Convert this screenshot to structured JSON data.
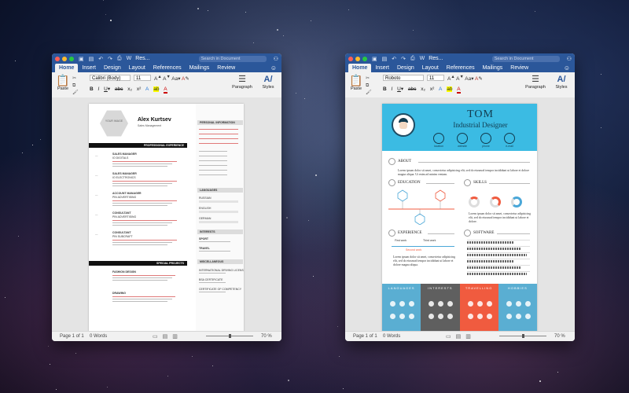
{
  "left_window": {
    "title": "Res...",
    "search_placeholder": "Search in Document",
    "tabs": [
      "Home",
      "Insert",
      "Design",
      "Layout",
      "References",
      "Mailings",
      "Review"
    ],
    "active_tab": "Home",
    "ribbon": {
      "paste_label": "Paste",
      "font_name": "Calibri (Body)",
      "font_size": "11",
      "paragraph_label": "Paragraph",
      "styles_label": "Styles"
    },
    "status": {
      "page": "Page 1 of 1",
      "words": "0 Words",
      "zoom": "70 %"
    },
    "resume": {
      "photo_label": "YOUR IMAGE",
      "name": "Alex Kurtsev",
      "role": "Sales Management",
      "professional_experience": "PROFESSIONAL EXPERIENCE",
      "special_projects": "SPECIAL PROJECTS",
      "personal_information": "PERSONAL INFORMATION",
      "languages": "LANGUAGES",
      "interests": "INTERESTS",
      "miscellaneous": "MISCELLANEOUS",
      "jobs": [
        {
          "title": "SALES MANAGER",
          "company": "IO DIGITALS"
        },
        {
          "title": "SALES MANAGER",
          "company": "IO ELECTRONICS"
        },
        {
          "title": "ACCOUNT MANAGER",
          "company": "PIN ADVERTISING"
        },
        {
          "title": "CONSULTANT",
          "company": "PIN ADVERTISING"
        },
        {
          "title": "CONSULTANT",
          "company": "PIN SUBCRAFT"
        }
      ],
      "projects": [
        {
          "title": "FASHION DESIGN"
        },
        {
          "title": "DRAWING"
        }
      ],
      "language_items": [
        "RUSSIAN",
        "ENGLISH",
        "GERMAN"
      ],
      "interest_items": [
        "SPORT",
        "TRAVEL"
      ],
      "misc_items": [
        "INTERNATIONAL DRIVING LICENSE",
        "BSA CERTIFICATE",
        "CERTIFICATE OF COMPETENCY"
      ]
    }
  },
  "right_window": {
    "title": "Res...",
    "search_placeholder": "Search in Document",
    "tabs": [
      "Home",
      "Insert",
      "Design",
      "Layout",
      "References",
      "Mailings",
      "Review"
    ],
    "active_tab": "Home",
    "ribbon": {
      "paste_label": "Paste",
      "font_name": "Roboto",
      "font_size": "11",
      "paragraph_label": "Paragraph",
      "styles_label": "Styles"
    },
    "status": {
      "page": "Page 1 of 1",
      "words": "0 Words",
      "zoom": "70 %"
    },
    "resume": {
      "name": "TOM",
      "title": "Industrial Designer",
      "contacts": [
        "location",
        "website",
        "phone",
        "e-mail"
      ],
      "about_heading": "ABOUT",
      "about_text": "Lorem ipsum dolor sit amet, consectetur adipisicing elit, sed do eiusmod tempor incididunt ut labore et dolore magna aliqua. Ut enim ad minim veniam.",
      "education_heading": "EDUCATION",
      "skills_heading": "SKILLS",
      "skills_text": "Lorem ipsum dolor sit amet, consectetur adipisicing elit, sed do eiusmod tempor incididunt ut labore et dolore.",
      "experience_heading": "EXPERIENCE",
      "software_heading": "SOFTWARE",
      "experience_items": [
        "First work",
        "Third work",
        "Second work"
      ],
      "experience_text": "Lorem ipsum dolor sit amet, consectetur adipisicing elit, sed do eiusmod tempor incididunt ut labore et dolore magna aliqua.",
      "panels": [
        {
          "title": "LANGUAGES",
          "color": "#5aaed2"
        },
        {
          "title": "INTERESTS",
          "color": "#5f5f5f"
        },
        {
          "title": "TRAVELLING",
          "color": "#f05b3f"
        },
        {
          "title": "HOBBIES",
          "color": "#5aaed2"
        }
      ],
      "header_color": "#3bbbe3"
    }
  },
  "colors": {
    "word_blue": "#2b579a"
  }
}
